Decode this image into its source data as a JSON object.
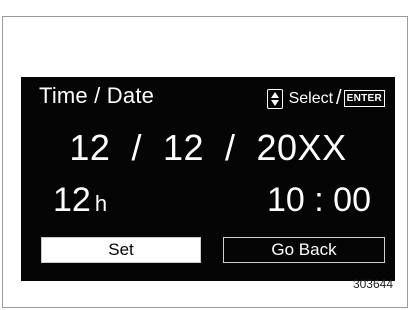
{
  "header": {
    "title": "Time / Date",
    "hint_select": "Select",
    "hint_separator": "/",
    "hint_enter": "ENTER",
    "hint_icon": "up-down-arrows-icon"
  },
  "date": {
    "display": "12  /  12  /  20XX"
  },
  "time": {
    "hour_format": "12",
    "hour_unit": "h",
    "display": "10 : 00"
  },
  "buttons": {
    "set_label": "Set",
    "back_label": "Go Back",
    "selected": "Set"
  },
  "figure_id": "303644",
  "colors": {
    "screen_bg": "#050505",
    "text": "#ffffff",
    "selected_button_bg": "#ffffff"
  }
}
